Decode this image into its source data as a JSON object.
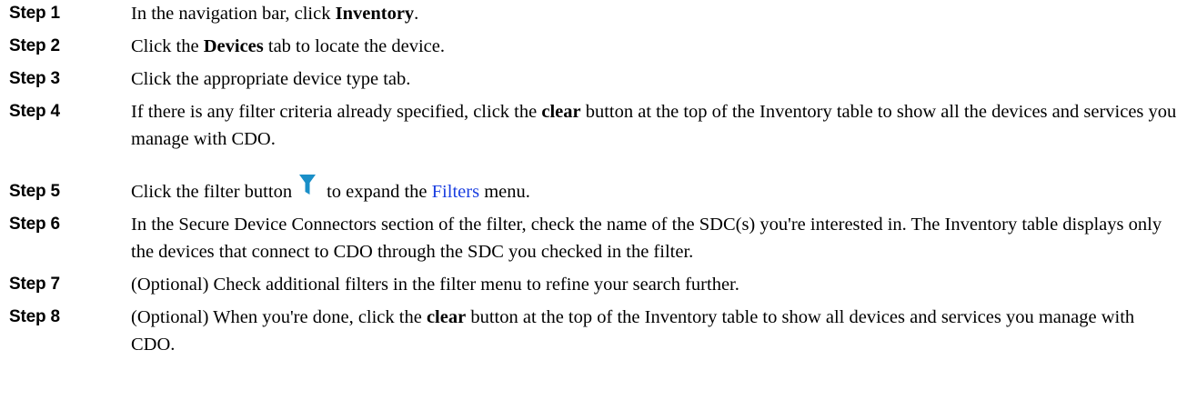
{
  "steps": [
    {
      "label": "Step 1",
      "parts": [
        "In the navigation bar, click ",
        "Inventory",
        "."
      ]
    },
    {
      "label": "Step 2",
      "parts": [
        "Click the ",
        "Devices",
        " tab to locate the device."
      ]
    },
    {
      "label": "Step 3",
      "parts": [
        "Click the appropriate device type tab."
      ]
    },
    {
      "label": "Step 4",
      "parts": [
        "If there is any filter criteria already specified, click the ",
        "clear",
        " button at the top of the Inventory table to show all the devices and services you manage with CDO."
      ]
    },
    {
      "label": "Step 5",
      "parts": [
        "Click the filter button",
        "to expand the ",
        "Filters",
        " menu."
      ],
      "icon": "filter-funnel-icon",
      "icon_color": "#1a8fc8"
    },
    {
      "label": "Step 6",
      "parts": [
        "In the Secure Device Connectors section of the filter, check the name of the SDC(s) you're interested in. The Inventory table displays only the devices that connect to CDO through the SDC you checked in the filter."
      ]
    },
    {
      "label": "Step 7",
      "parts": [
        "(Optional) Check additional filters in the filter menu to refine your search further."
      ]
    },
    {
      "label": "Step 8",
      "parts": [
        "(Optional) When you're done, click the ",
        "clear",
        " button at the top of the Inventory table to show all devices and services you manage with CDO."
      ]
    }
  ],
  "colors": {
    "link": "#1a3ee0",
    "icon": "#1a8fc8"
  }
}
